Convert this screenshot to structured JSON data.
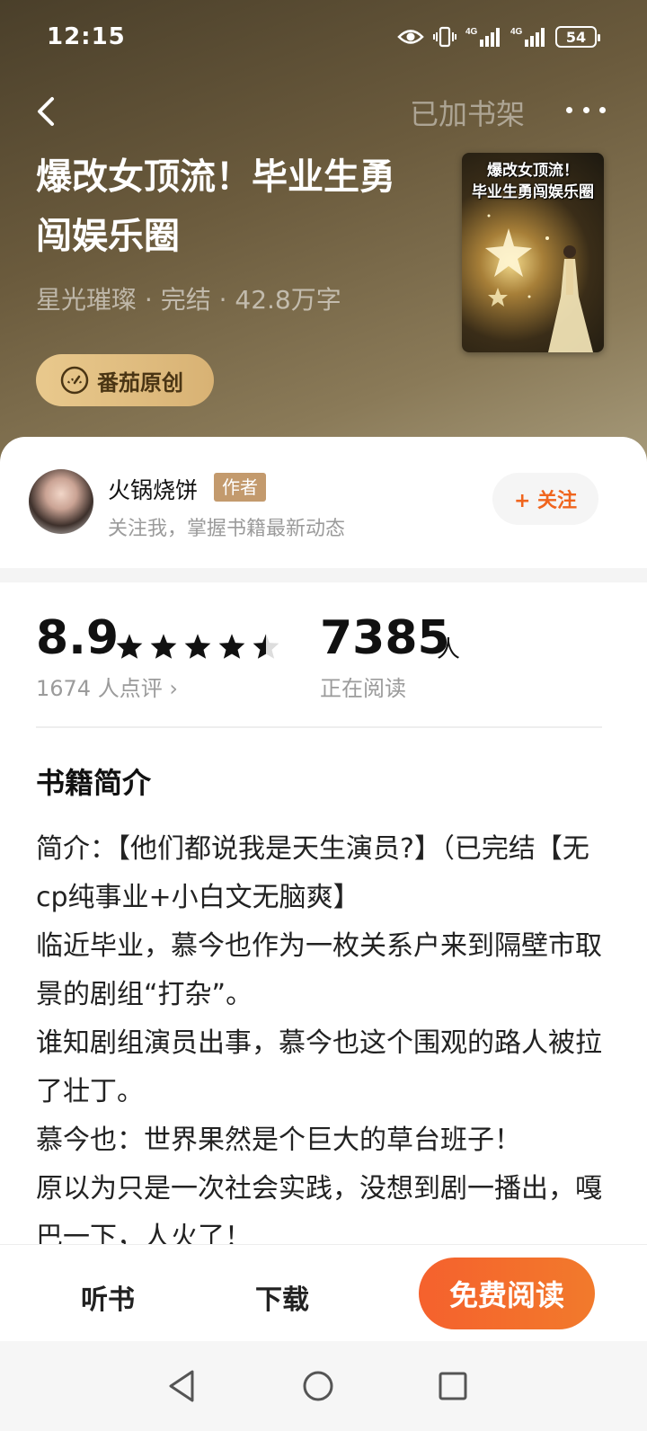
{
  "status_bar": {
    "time": "12:15",
    "signal_1": "4G",
    "signal_2": "4G",
    "battery": "54"
  },
  "nav": {
    "shelf_label": "已加书架"
  },
  "book": {
    "title": "爆改女顶流！毕业生勇闯娱乐圈",
    "meta": "星光璀璨 · 完结 · 42.8万字",
    "badge": "番茄原创",
    "cover_text_1": "爆改女顶流！",
    "cover_text_2": "毕业生勇闯娱乐圈"
  },
  "author": {
    "name": "火锅烧饼",
    "tag": "作者",
    "desc": "关注我，掌握书籍最新动态",
    "follow_label": "+ 关注"
  },
  "stats": {
    "score": "8.9",
    "stars": 4.5,
    "reviews": "1674 人点评 ›",
    "readers": "7385",
    "readers_unit": "人",
    "reading_label": "正在阅读"
  },
  "intro": {
    "title": "书籍简介",
    "lines": [
      "简介：【他们都说我是天生演员?】（已完结【无cp纯事业+小白文无脑爽】",
      "临近毕业，慕今也作为一枚关系户来到隔壁市取景的剧组“打杂”。",
      "谁知剧组演员出事，慕今也这个围观的路人被拉了壮丁。",
      "慕今也：世界果然是个巨大的草台班子！",
      "原以为只是一次社会实践，没想到剧一播出，嘎巴一下，人火了！"
    ]
  },
  "bottom_bar": {
    "listen": "听书",
    "download": "下载",
    "read": "免费阅读"
  },
  "colors": {
    "accent": "#f5612d",
    "follow": "#f0651e",
    "author_tag": "#c39a6d",
    "badge": "#e9c98d"
  },
  "icons": [
    "eye-icon",
    "vibrate-icon",
    "signal-icon",
    "battery-icon",
    "back-arrow-icon",
    "more-icon",
    "dial-icon",
    "star-icon",
    "back-triangle-icon",
    "home-circle-icon",
    "recents-square-icon"
  ]
}
